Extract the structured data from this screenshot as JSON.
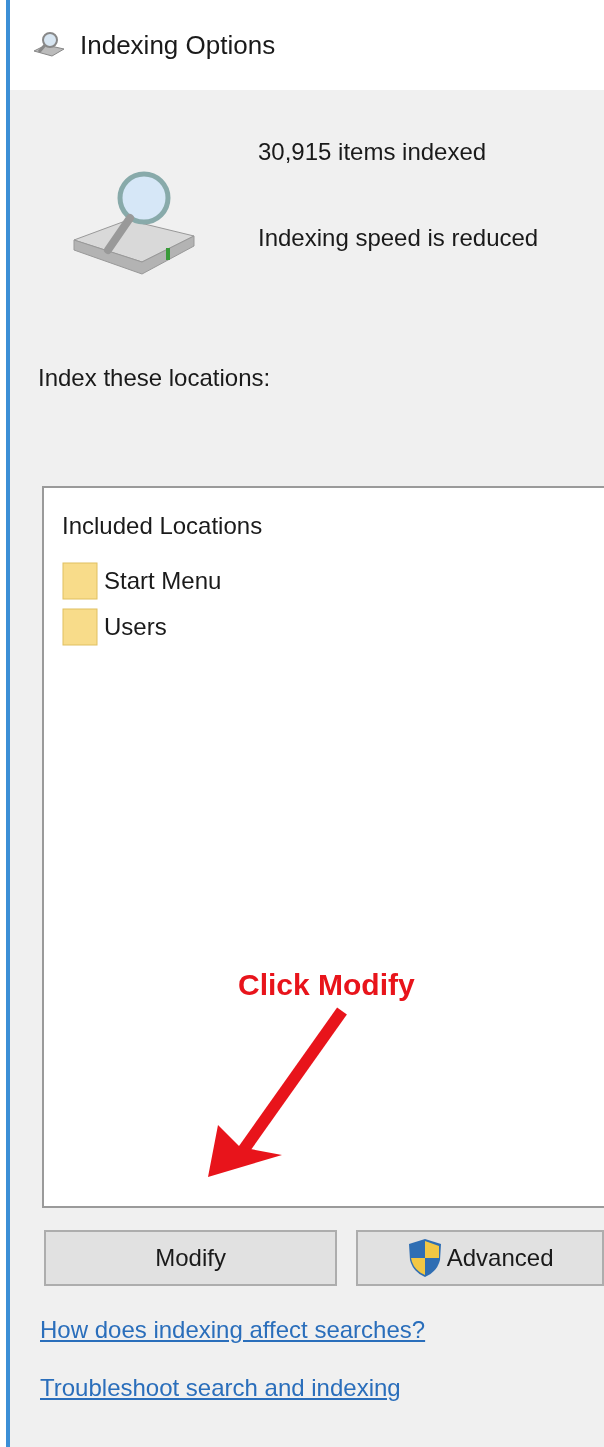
{
  "window": {
    "title": "Indexing Options"
  },
  "status": [
    "30,915 items indexed",
    "Indexing speed is reduced"
  ],
  "locations_label": "Index these locations:",
  "locations": {
    "header": "Included Locations",
    "items": [
      {
        "name": "Start Menu"
      },
      {
        "name": "Users"
      }
    ]
  },
  "buttons": [
    {
      "label": "Modify",
      "kind": "plain"
    },
    {
      "label": "Advanced",
      "kind": "shield"
    }
  ],
  "links": [
    "How does indexing affect searches?",
    "Troubleshoot search and indexing"
  ],
  "annotation": {
    "text": "Click Modify"
  }
}
